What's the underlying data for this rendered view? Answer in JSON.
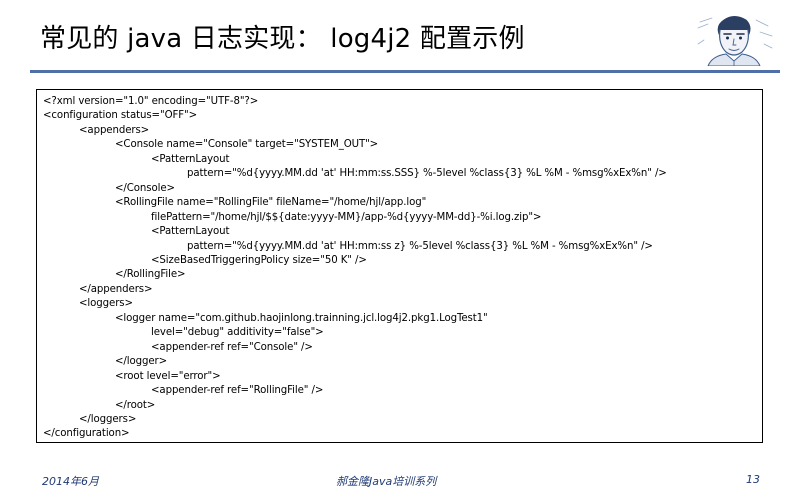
{
  "slide": {
    "title": "常见的 java 日志实现： log4j2 配置示例",
    "portrait_icon": "author-portrait-icon"
  },
  "code": {
    "lines": [
      {
        "indent": 0,
        "text": "<?xml version=\"1.0\" encoding=\"UTF-8\"?>"
      },
      {
        "indent": 0,
        "text": "<configuration status=\"OFF\">"
      },
      {
        "indent": 1,
        "text": "<appenders>"
      },
      {
        "indent": 2,
        "text": "<Console name=\"Console\" target=\"SYSTEM_OUT\">"
      },
      {
        "indent": 3,
        "text": "<PatternLayout"
      },
      {
        "indent": 4,
        "text": "pattern=\"%d{yyyy.MM.dd 'at' HH:mm:ss.SSS} %-5level %class{3} %L %M - %msg%xEx%n\" />"
      },
      {
        "indent": 2,
        "text": "</Console>"
      },
      {
        "indent": 2,
        "text": "<RollingFile name=\"RollingFile\" fileName=\"/home/hjl/app.log\""
      },
      {
        "indent": 3,
        "text": "filePattern=\"/home/hjl/$${date:yyyy-MM}/app-%d{yyyy-MM-dd}-%i.log.zip\">"
      },
      {
        "indent": 3,
        "text": "<PatternLayout"
      },
      {
        "indent": 4,
        "text": "pattern=\"%d{yyyy.MM.dd 'at' HH:mm:ss z} %-5level %class{3} %L %M - %msg%xEx%n\" />"
      },
      {
        "indent": 3,
        "text": "<SizeBasedTriggeringPolicy size=\"50 K\" />"
      },
      {
        "indent": 2,
        "text": "</RollingFile>"
      },
      {
        "indent": 1,
        "text": "</appenders>"
      },
      {
        "indent": 1,
        "text": "<loggers>"
      },
      {
        "indent": 2,
        "text": "<logger name=\"com.github.haojinlong.trainning.jcl.log4j2.pkg1.LogTest1\""
      },
      {
        "indent": 3,
        "text": "level=\"debug\" additivity=\"false\">"
      },
      {
        "indent": 3,
        "text": "<appender-ref ref=\"Console\" />"
      },
      {
        "indent": 2,
        "text": "</logger>"
      },
      {
        "indent": 2,
        "text": "<root level=\"error\">"
      },
      {
        "indent": 3,
        "text": "<appender-ref ref=\"RollingFile\" />"
      },
      {
        "indent": 2,
        "text": "</root>"
      },
      {
        "indent": 1,
        "text": "</loggers>"
      },
      {
        "indent": 0,
        "text": "</configuration>"
      }
    ]
  },
  "footer": {
    "date": "2014年6月",
    "series": "郝金隆Java培训系列",
    "page": "13"
  },
  "colors": {
    "rule": "#4f6fa8",
    "footer_text": "#1f3a73"
  }
}
